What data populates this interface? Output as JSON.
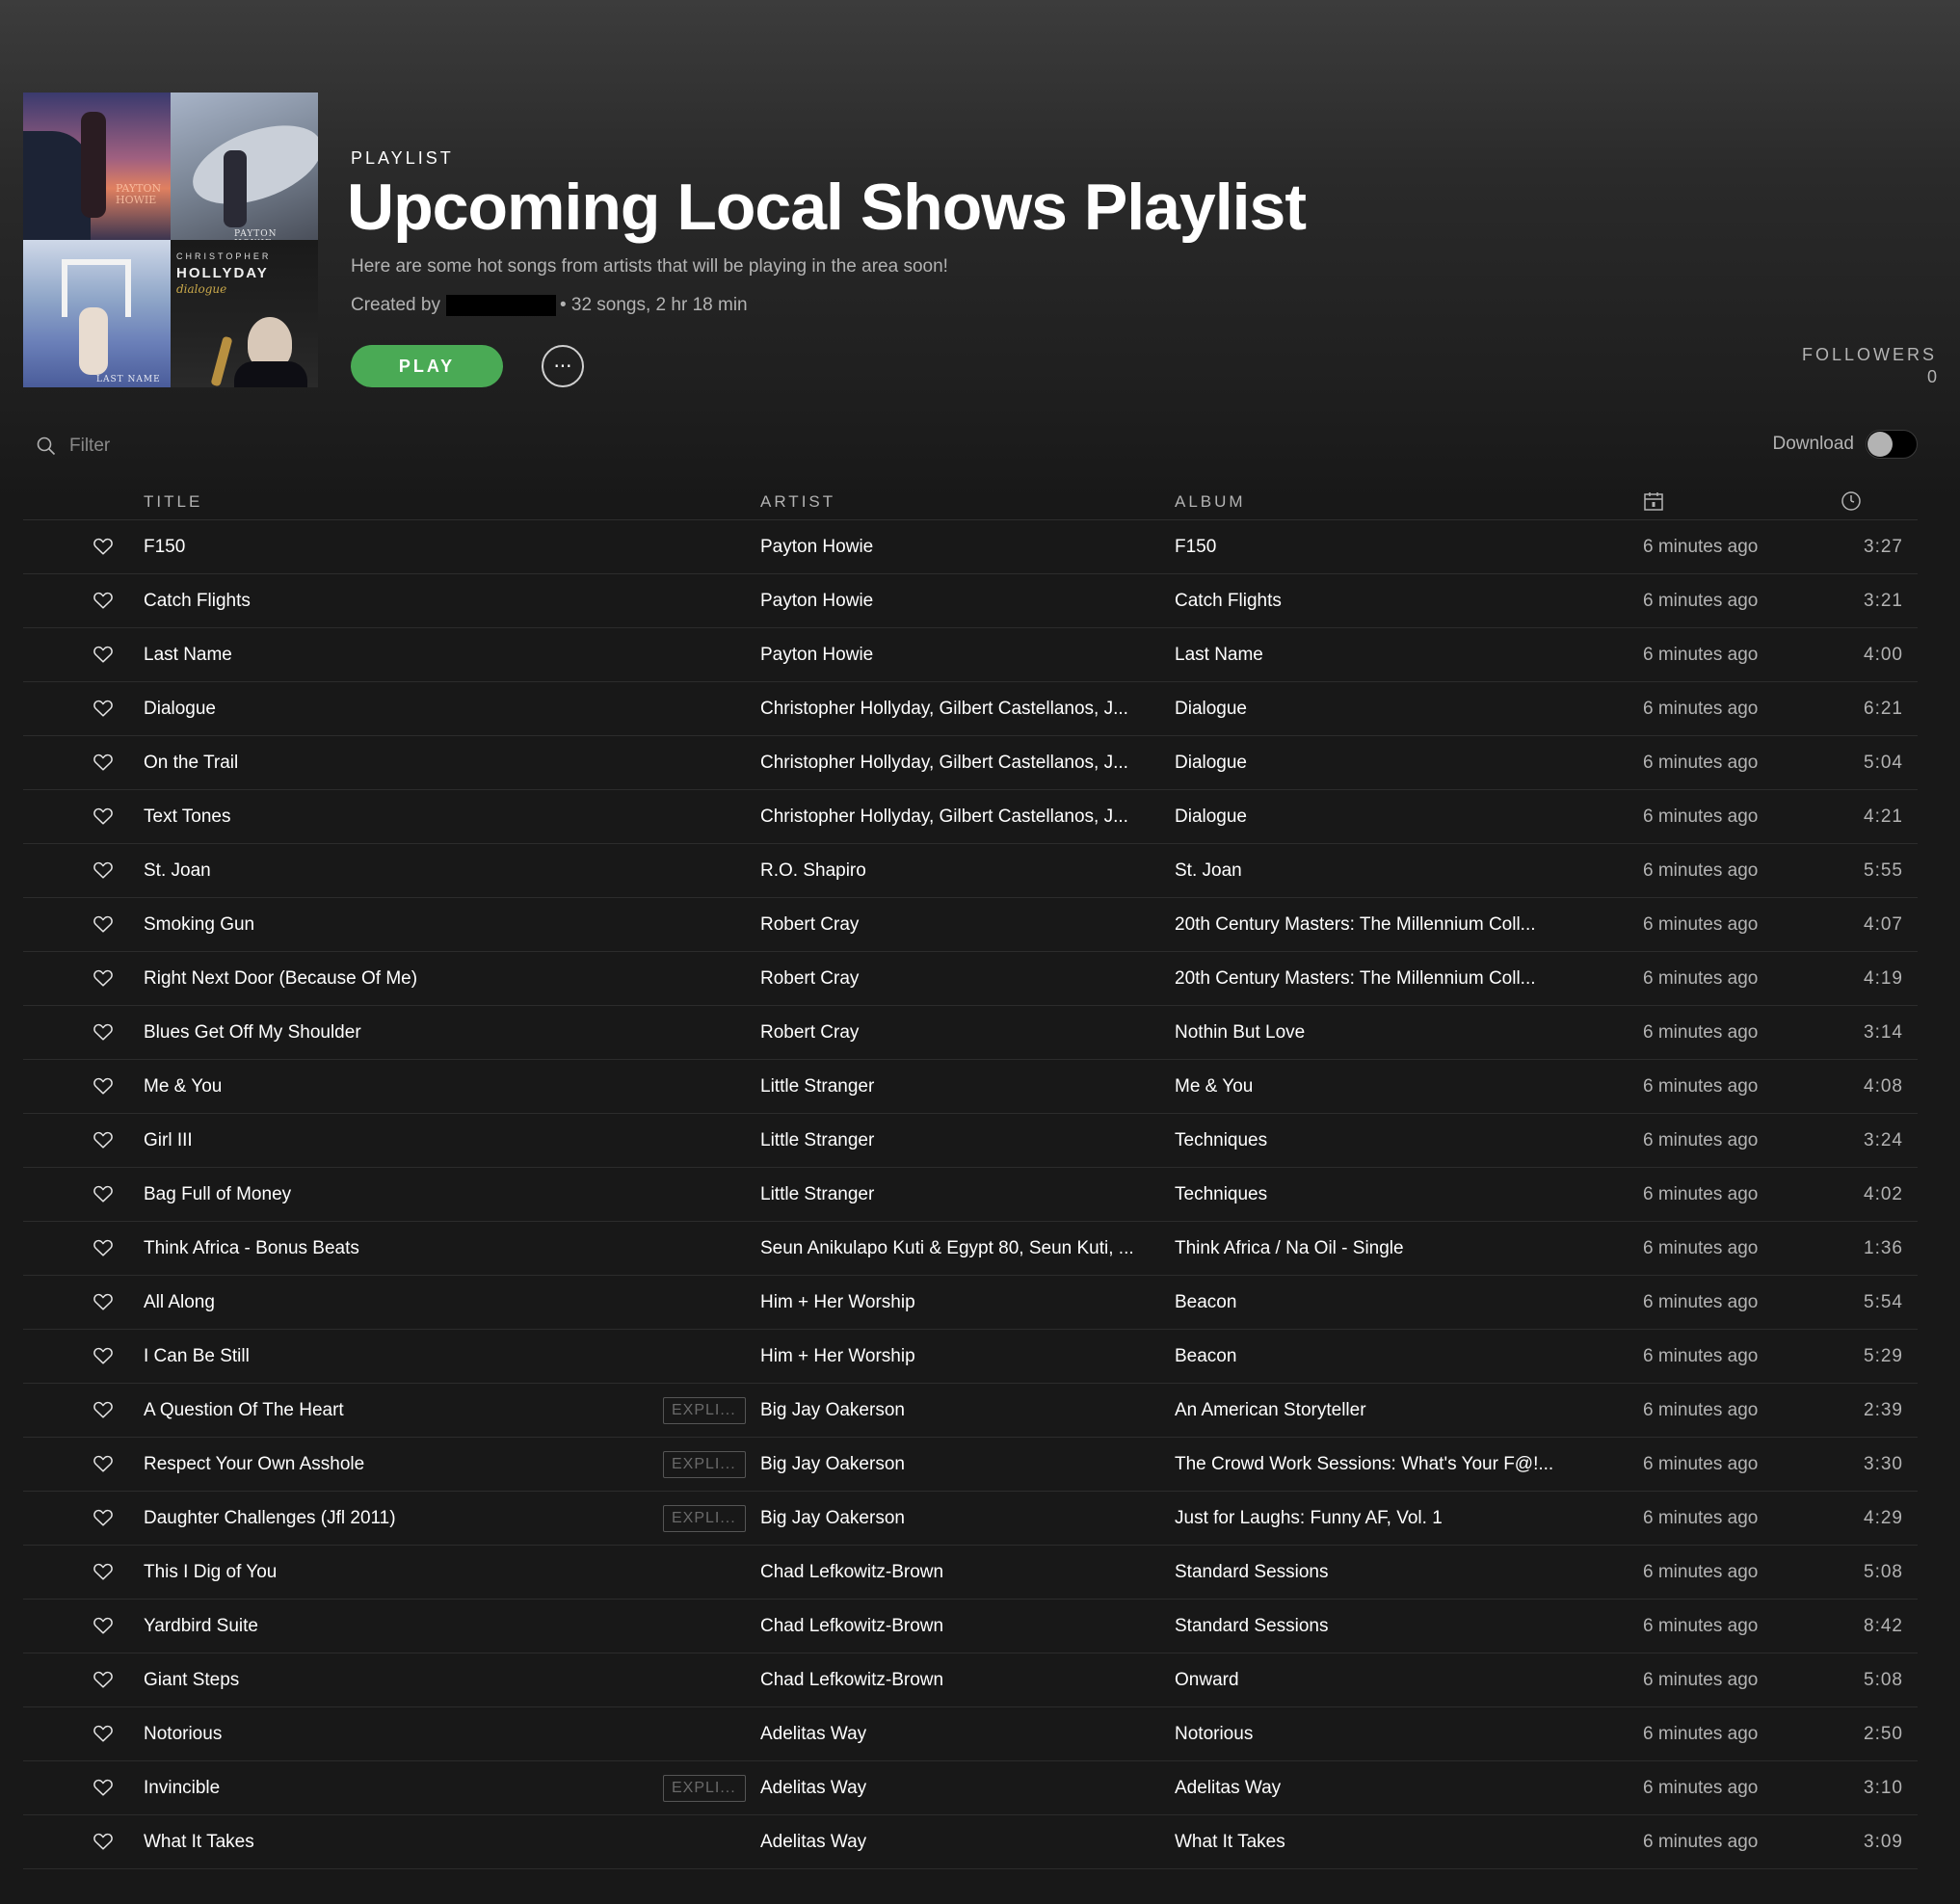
{
  "playlist": {
    "type_label": "PLAYLIST",
    "title": "Upcoming Local Shows Playlist",
    "description": "Here are some hot songs from artists that will be playing in the area soon!",
    "created_by_label": "Created by",
    "stats": "• 32 songs, 2 hr 18 min",
    "play_label": "PLAY",
    "more_label": "···",
    "followers_label": "FOLLOWERS",
    "followers_count": "0"
  },
  "cover": {
    "tile1_text": "PAYTON HOWIE",
    "tile2_text": "PAYTON HOWIE",
    "tile3_text": "LAST NAME",
    "tile4_top": "CHRISTOPHER",
    "tile4_name": "HOLLYDAY",
    "tile4_sub": "dialogue"
  },
  "filter": {
    "placeholder": "Filter"
  },
  "download": {
    "label": "Download",
    "enabled": false
  },
  "columns": {
    "title": "TITLE",
    "artist": "ARTIST",
    "album": "ALBUM"
  },
  "colors": {
    "accent": "#4aaa55",
    "background": "#181818",
    "secondary_text": "#b3b3b3"
  },
  "tracks": [
    {
      "title": "F150",
      "explicit": "",
      "artist": "Payton Howie",
      "album": "F150",
      "added": "6 minutes ago",
      "duration": "3:27"
    },
    {
      "title": "Catch Flights",
      "explicit": "",
      "artist": "Payton Howie",
      "album": "Catch Flights",
      "added": "6 minutes ago",
      "duration": "3:21"
    },
    {
      "title": "Last Name",
      "explicit": "",
      "artist": "Payton Howie",
      "album": "Last Name",
      "added": "6 minutes ago",
      "duration": "4:00"
    },
    {
      "title": "Dialogue",
      "explicit": "",
      "artist": "Christopher Hollyday, Gilbert Castellanos, J...",
      "album": "Dialogue",
      "added": "6 minutes ago",
      "duration": "6:21"
    },
    {
      "title": "On the Trail",
      "explicit": "",
      "artist": "Christopher Hollyday, Gilbert Castellanos, J...",
      "album": "Dialogue",
      "added": "6 minutes ago",
      "duration": "5:04"
    },
    {
      "title": "Text Tones",
      "explicit": "",
      "artist": "Christopher Hollyday, Gilbert Castellanos, J...",
      "album": "Dialogue",
      "added": "6 minutes ago",
      "duration": "4:21"
    },
    {
      "title": "St. Joan",
      "explicit": "",
      "artist": "R.O. Shapiro",
      "album": "St. Joan",
      "added": "6 minutes ago",
      "duration": "5:55"
    },
    {
      "title": "Smoking Gun",
      "explicit": "",
      "artist": "Robert Cray",
      "album": "20th Century Masters: The Millennium Coll...",
      "added": "6 minutes ago",
      "duration": "4:07"
    },
    {
      "title": "Right Next Door (Because Of Me)",
      "explicit": "",
      "artist": "Robert Cray",
      "album": "20th Century Masters: The Millennium Coll...",
      "added": "6 minutes ago",
      "duration": "4:19"
    },
    {
      "title": "Blues Get Off My Shoulder",
      "explicit": "",
      "artist": "Robert Cray",
      "album": "Nothin But Love",
      "added": "6 minutes ago",
      "duration": "3:14"
    },
    {
      "title": "Me & You",
      "explicit": "",
      "artist": "Little Stranger",
      "album": "Me & You",
      "added": "6 minutes ago",
      "duration": "4:08"
    },
    {
      "title": "Girl III",
      "explicit": "",
      "artist": "Little Stranger",
      "album": "Techniques",
      "added": "6 minutes ago",
      "duration": "3:24"
    },
    {
      "title": "Bag Full of Money",
      "explicit": "",
      "artist": "Little Stranger",
      "album": "Techniques",
      "added": "6 minutes ago",
      "duration": "4:02"
    },
    {
      "title": "Think Africa - Bonus Beats",
      "explicit": "",
      "artist": "Seun Anikulapo Kuti & Egypt 80, Seun Kuti, ...",
      "album": "Think Africa / Na Oil - Single",
      "added": "6 minutes ago",
      "duration": "1:36"
    },
    {
      "title": "All Along",
      "explicit": "",
      "artist": "Him + Her Worship",
      "album": "Beacon",
      "added": "6 minutes ago",
      "duration": "5:54"
    },
    {
      "title": "I Can Be Still",
      "explicit": "",
      "artist": "Him + Her Worship",
      "album": "Beacon",
      "added": "6 minutes ago",
      "duration": "5:29"
    },
    {
      "title": "A Question Of The Heart",
      "explicit": "EXPLI...",
      "artist": "Big Jay Oakerson",
      "album": "An American Storyteller",
      "added": "6 minutes ago",
      "duration": "2:39"
    },
    {
      "title": "Respect Your Own Asshole",
      "explicit": "EXPLI...",
      "artist": "Big Jay Oakerson",
      "album": "The Crowd Work Sessions: What's Your F@!...",
      "added": "6 minutes ago",
      "duration": "3:30"
    },
    {
      "title": "Daughter Challenges (Jfl 2011)",
      "explicit": "EXPLI...",
      "artist": "Big Jay Oakerson",
      "album": "Just for Laughs: Funny AF, Vol. 1",
      "added": "6 minutes ago",
      "duration": "4:29"
    },
    {
      "title": "This I Dig of You",
      "explicit": "",
      "artist": "Chad Lefkowitz-Brown",
      "album": "Standard Sessions",
      "added": "6 minutes ago",
      "duration": "5:08"
    },
    {
      "title": "Yardbird Suite",
      "explicit": "",
      "artist": "Chad Lefkowitz-Brown",
      "album": "Standard Sessions",
      "added": "6 minutes ago",
      "duration": "8:42"
    },
    {
      "title": "Giant Steps",
      "explicit": "",
      "artist": "Chad Lefkowitz-Brown",
      "album": "Onward",
      "added": "6 minutes ago",
      "duration": "5:08"
    },
    {
      "title": "Notorious",
      "explicit": "",
      "artist": "Adelitas Way",
      "album": "Notorious",
      "added": "6 minutes ago",
      "duration": "2:50"
    },
    {
      "title": "Invincible",
      "explicit": "EXPLI...",
      "artist": "Adelitas Way",
      "album": "Adelitas Way",
      "added": "6 minutes ago",
      "duration": "3:10"
    },
    {
      "title": "What It Takes",
      "explicit": "",
      "artist": "Adelitas Way",
      "album": "What It Takes",
      "added": "6 minutes ago",
      "duration": "3:09"
    }
  ]
}
